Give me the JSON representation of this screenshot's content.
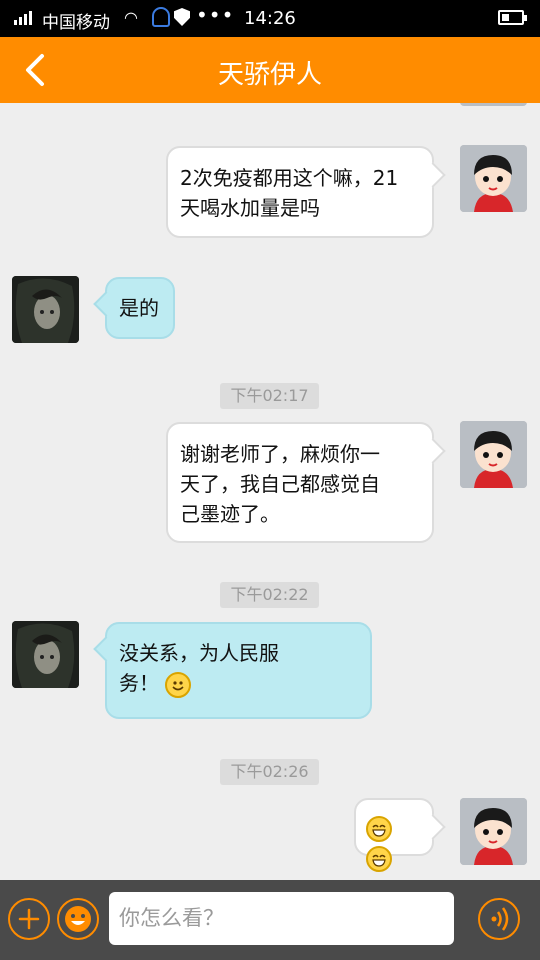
{
  "statusbar": {
    "carrier": "中国移动",
    "time": "14:26"
  },
  "header": {
    "title": "天骄伊人"
  },
  "messages": [
    {
      "sender": "me",
      "text_line1": "2次免疫都用这个嘛，21",
      "text_line2": "天喝水加量是吗"
    },
    {
      "sender": "other",
      "text": "是的"
    },
    {
      "type": "time",
      "text": "下午02:17"
    },
    {
      "sender": "me",
      "text_line1": "谢谢老师了，麻烦你一",
      "text_line2": "天了，我自己都感觉自",
      "text_line3": "己墨迹了。"
    },
    {
      "type": "time",
      "text": "下午02:22"
    },
    {
      "sender": "other",
      "text_line1": "没关系，为人民服",
      "text_line2": "务！"
    },
    {
      "type": "time",
      "text": "下午02:26"
    },
    {
      "sender": "me",
      "emoji": "grin-emoji"
    }
  ],
  "composer": {
    "placeholder": "你怎么看？"
  },
  "colors": {
    "accent": "#ff8c00",
    "incoming_bubble": "#bdebf2",
    "outgoing_bubble": "#ffffff",
    "background": "#eeeeee"
  }
}
